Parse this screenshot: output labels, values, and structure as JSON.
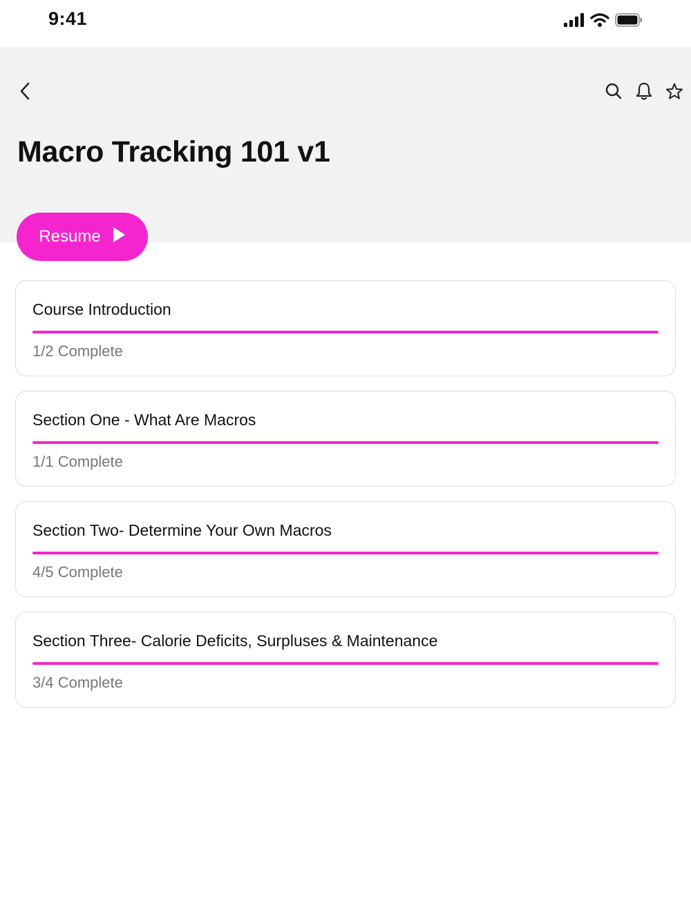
{
  "status_bar": {
    "time": "9:41"
  },
  "header": {
    "title": "Macro Tracking 101 v1"
  },
  "resume_button": {
    "label": "Resume"
  },
  "colors": {
    "accent": "#f425cf",
    "header_bg": "#f2f2f2"
  },
  "sections": [
    {
      "title": "Course Introduction",
      "status": "1/2 Complete",
      "progress": 1.0
    },
    {
      "title": "Section One - What Are Macros",
      "status": "1/1 Complete",
      "progress": 1.0
    },
    {
      "title": "Section Two- Determine Your Own Macros",
      "status": "4/5 Complete",
      "progress": 1.0
    },
    {
      "title": "Section Three- Calorie Deficits, Surpluses & Maintenance",
      "status": "3/4 Complete",
      "progress": 1.0
    }
  ]
}
